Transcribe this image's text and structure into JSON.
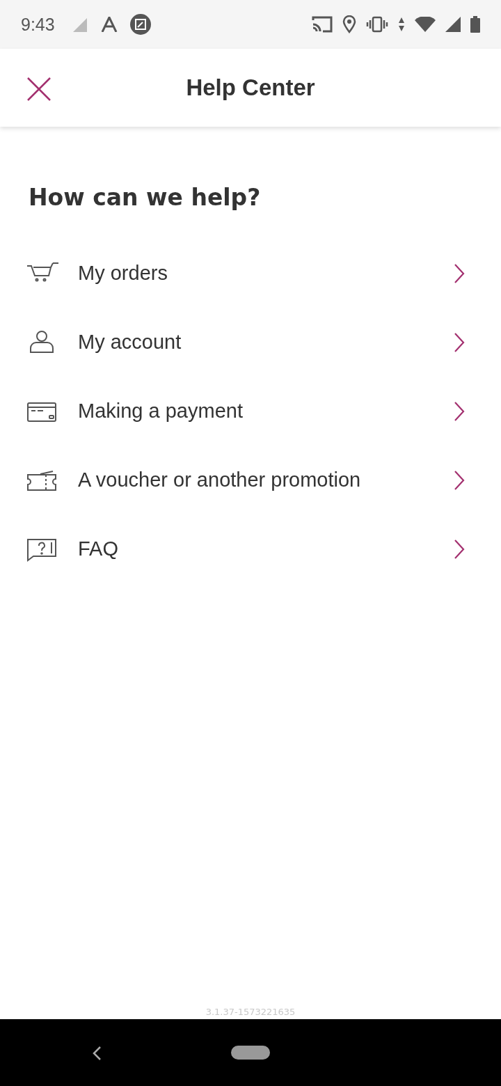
{
  "status_bar": {
    "time": "9:43"
  },
  "header": {
    "title": "Help Center"
  },
  "heading": "How can we help?",
  "items": [
    {
      "kind": "cart",
      "label": "My orders"
    },
    {
      "kind": "person",
      "label": "My account"
    },
    {
      "kind": "card",
      "label": "Making a payment"
    },
    {
      "kind": "ticket",
      "label": "A voucher or another promotion"
    },
    {
      "kind": "question",
      "label": "FAQ"
    }
  ],
  "version": "3.1.37-1573221635"
}
